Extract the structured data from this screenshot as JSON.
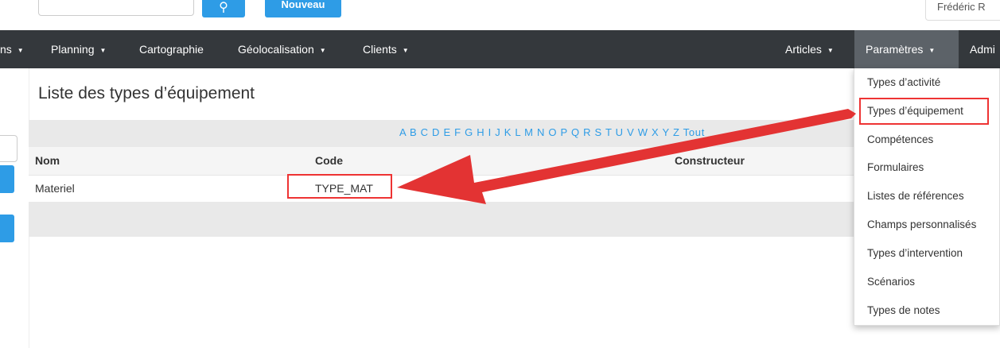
{
  "topbar": {
    "search_icon": "search-icon",
    "new_label": "Nouveau",
    "user_label": "Frédéric R"
  },
  "nav": {
    "items_left": [
      {
        "label": "ns"
      },
      {
        "label": "Planning"
      },
      {
        "label": "Cartographie"
      },
      {
        "label": "Géolocalisation"
      },
      {
        "label": "Clients"
      }
    ],
    "items_right": [
      {
        "label": "Articles"
      },
      {
        "label": "Paramètres"
      },
      {
        "label": "Admi"
      }
    ]
  },
  "page": {
    "title": "Liste des types d’équipement",
    "alphabet": "A B C D E F G H I J K L M N O P Q R S T U V W X Y Z Tout"
  },
  "table": {
    "columns": [
      "Nom",
      "Code",
      "Constructeur"
    ],
    "rows": [
      {
        "nom": "Materiel",
        "code": "TYPE_MAT",
        "constructeur": ""
      }
    ]
  },
  "dropdown": {
    "items": [
      "Types d’activité",
      "Types d’équipement",
      "Compétences",
      "Formulaires",
      "Listes de références",
      "Champs personnalisés",
      "Types d’intervention",
      "Scénarios",
      "Types de notes"
    ]
  },
  "colors": {
    "nav_bg": "#34383c",
    "accent": "#2e9ce6",
    "annotation": "#e33333"
  }
}
